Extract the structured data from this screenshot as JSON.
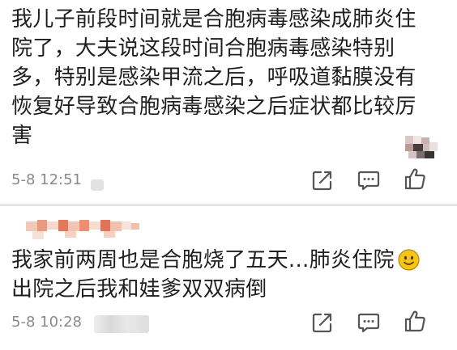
{
  "comments": [
    {
      "lines": [
        "我儿子前段时间就是合胞病毒感染成肺炎住",
        "院了，大夫说这段时间合胞病毒感染特别",
        "多，特别是感染甲流之后，呼吸道黏膜没有",
        "恢复好导致合胞病毒感染之后症状都比较厉",
        "害"
      ],
      "timestamp": "5-8 12:51"
    },
    {
      "lines": [
        "我家前两周也是合胞烧了五天...肺炎住院",
        "出院之后我和娃爹双双病倒"
      ],
      "timestamp": "5-8 10:28"
    }
  ],
  "icons": {
    "share": "share-icon",
    "reply": "comment-icon",
    "like": "thumbs-up-icon",
    "emoji": "smile-emoji-icon"
  },
  "colors": {
    "text": "#1f1f1f",
    "meta": "#8a8a8a",
    "icon": "#555555",
    "emoji": "#f5c518"
  }
}
